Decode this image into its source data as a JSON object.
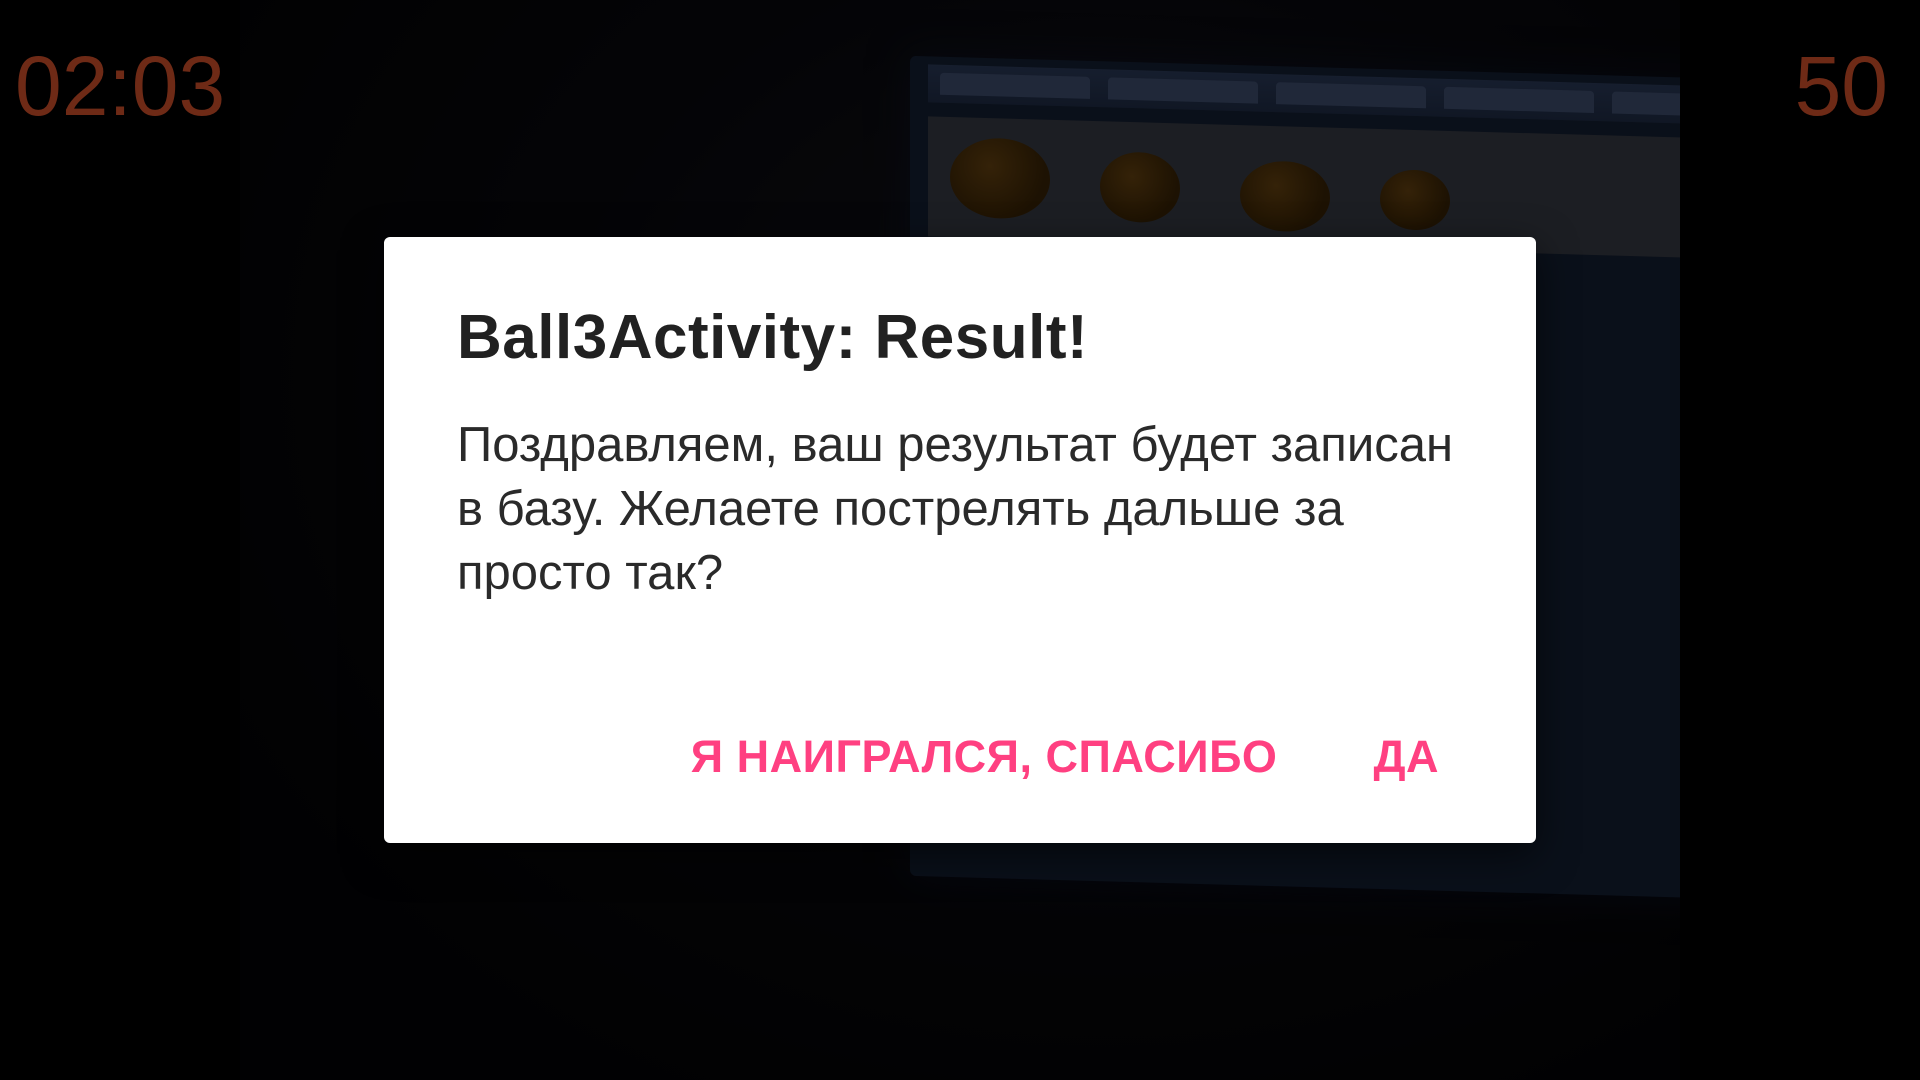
{
  "hud": {
    "timer": "02:03",
    "score": "50"
  },
  "dialog": {
    "title": "Ball3Activity: Result!",
    "message": "Поздравляем, ваш результат будет записан в базу. Желаете пострелять дальше за просто так?",
    "negative_button": "Я НАИГРАЛСЯ, СПАСИБО",
    "positive_button": "ДА"
  },
  "colors": {
    "accent": "#ff4081",
    "hud_text": "#6e2a16",
    "dialog_background": "#ffffff",
    "title_text": "#212121"
  }
}
